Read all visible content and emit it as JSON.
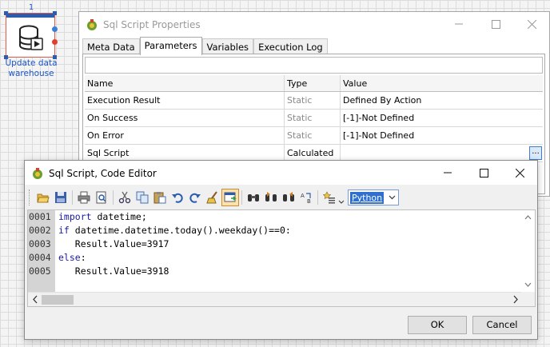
{
  "canvas": {
    "node": {
      "index": "1",
      "label_line1": "Update data",
      "label_line2": "warehouse",
      "icon": "database-script-icon"
    }
  },
  "properties_window": {
    "title": "Sql Script Properties",
    "tabs": [
      {
        "label": "Meta Data",
        "active": false
      },
      {
        "label": "Parameters",
        "active": true
      },
      {
        "label": "Variables",
        "active": false
      },
      {
        "label": "Execution Log",
        "active": false
      }
    ],
    "filter": {
      "value": ""
    },
    "grid": {
      "headers": {
        "name": "Name",
        "type": "Type",
        "value": "Value"
      },
      "rows": [
        {
          "name": "Execution Result",
          "type": "Static",
          "value": "Defined By Action"
        },
        {
          "name": "On Success",
          "type": "Static",
          "value": "[-1]-Not Defined"
        },
        {
          "name": "On Error",
          "type": "Static",
          "value": "[-1]-Not Defined"
        },
        {
          "name": "Sql Script",
          "type": "Calculated",
          "value": "",
          "button": "..."
        }
      ]
    }
  },
  "editor_window": {
    "title": "Sql Script, Code Editor",
    "toolbar_icons": [
      "open-icon",
      "save-icon",
      "print-icon",
      "print-preview-icon",
      "cut-icon",
      "copy-icon",
      "paste-icon",
      "undo-icon",
      "redo-icon",
      "clear-icon",
      "insert-icon",
      "find-icon",
      "find-next-icon",
      "find-previous-icon",
      "replace-icon",
      "bookmark-icon"
    ],
    "language": {
      "selected": "Python"
    },
    "code": {
      "line_numbers": [
        "0001",
        "0002",
        "0003",
        "0004",
        "0005"
      ],
      "lines": [
        {
          "kw": "import",
          "rest": " datetime;"
        },
        {
          "kw": "if",
          "rest": " datetime.datetime.today().weekday()==0:"
        },
        {
          "kw": "",
          "rest": "   Result.Value=3917"
        },
        {
          "kw": "else",
          "rest": ":"
        },
        {
          "kw": "",
          "rest": "   Result.Value=3918"
        }
      ]
    },
    "buttons": {
      "ok": "OK",
      "cancel": "Cancel"
    }
  },
  "colors": {
    "accent": "#2a5db0",
    "node_border": "#e05a4a",
    "keyword": "#1a1aa6",
    "selection": "#2f6fd0"
  }
}
